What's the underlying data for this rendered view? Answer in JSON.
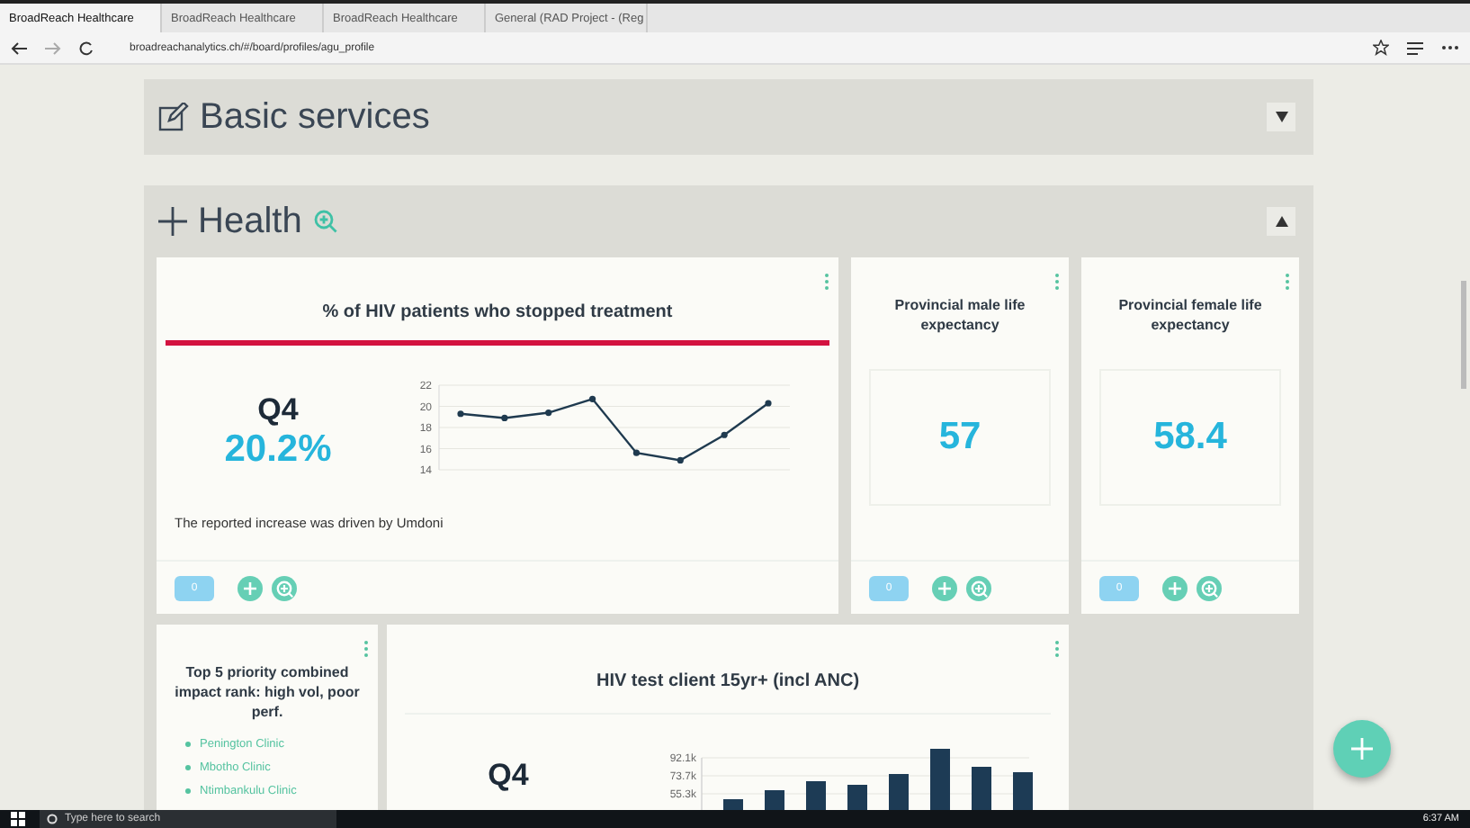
{
  "browser": {
    "tabs": [
      {
        "title": "BroadReach Healthcare",
        "selected": true
      },
      {
        "title": "BroadReach Healthcare",
        "selected": false
      },
      {
        "title": "BroadReach Healthcare",
        "selected": false
      },
      {
        "title": "General (RAD Project - (Reg",
        "selected": false
      }
    ],
    "url": "broadreachanalytics.ch/#/board/profiles/agu_profile"
  },
  "sections": [
    {
      "title": "Basic services",
      "expanded": false
    },
    {
      "title": "Health",
      "expanded": true
    }
  ],
  "cards": [
    {
      "kind": "line",
      "title": "% of HIV patients who stopped treatment",
      "period": "Q4",
      "value": "20.2%",
      "note": "The reported increase was driven by Umdoni",
      "comments": "0",
      "chart_data": {
        "type": "line",
        "series": [
          {
            "color": "#1f3a4f",
            "values": [
              19.3,
              18.9,
              19.4,
              20.7,
              15.6,
              14.9,
              17.3,
              20.3
            ]
          }
        ],
        "ylim": [
          14,
          22
        ],
        "yticks": [
          14,
          16,
          18,
          20,
          22
        ],
        "grid": true,
        "marker": true
      }
    },
    {
      "kind": "value",
      "title": "Provincial male life expectancy",
      "value": "57",
      "comments": "0"
    },
    {
      "kind": "value",
      "title": "Provincial female life expectancy",
      "value": "58.4",
      "comments": "0"
    },
    {
      "kind": "list",
      "title": "Top 5 priority combined impact rank: high vol, poor perf.",
      "items": [
        "Penington Clinic",
        "Mbotho Clinic",
        "Ntimbankulu Clinic"
      ]
    },
    {
      "kind": "bar",
      "title": "HIV test client 15yr+ (incl ANC)",
      "period": "Q4",
      "axis_labels": [
        "92.1k",
        "73.7k",
        "55.3k"
      ]
    }
  ],
  "taskbar": {
    "search_placeholder": "Type here to search",
    "time": "6:37 AM"
  }
}
